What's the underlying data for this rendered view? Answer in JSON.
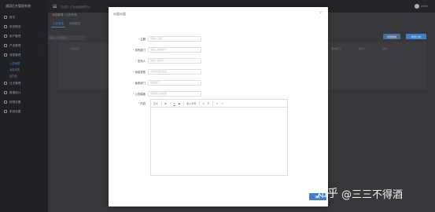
{
  "app": {
    "title": "通用后台管理系统",
    "notice": "欢迎您 · 平台运营管理中心",
    "user": "admin"
  },
  "sidebar": {
    "items": [
      {
        "label": "首页",
        "icon": "home-icon"
      },
      {
        "label": "系统概览",
        "icon": "dashboard-icon"
      },
      {
        "label": "用户管理",
        "icon": "user-icon",
        "arrow": "⌄"
      },
      {
        "label": "产品管理",
        "icon": "box-icon",
        "arrow": "⌄"
      },
      {
        "label": "消息管理",
        "icon": "message-icon",
        "arrow": "⌃"
      }
    ],
    "subitems": [
      {
        "label": "公告管理",
        "active": true
      },
      {
        "label": "消息列表",
        "active": false
      },
      {
        "label": "站内信",
        "active": false
      }
    ],
    "items2": [
      {
        "label": "日志管理",
        "icon": "log-icon"
      },
      {
        "label": "数据统计",
        "icon": "chart-icon"
      },
      {
        "label": "权限设置",
        "icon": "lock-icon"
      },
      {
        "label": "系统设置",
        "icon": "gear-icon"
      }
    ]
  },
  "background": {
    "breadcrumb": "消息管理 / 公告列表",
    "tabs": [
      "公告管理",
      "消息推送"
    ],
    "search_placeholder": "请输入公告标题",
    "buttons": [
      "批量删除",
      "新增公告"
    ],
    "columns": [
      "公告名称",
      "发布部门",
      "发布人",
      "操作"
    ]
  },
  "modal": {
    "title": "公告公告",
    "fields": [
      {
        "label": "主题",
        "required": true,
        "placeholder": "请输入主题",
        "select": false
      },
      {
        "label": "发布部门",
        "required": true,
        "placeholder": "请输入发布部门",
        "select": true
      },
      {
        "label": "发布人",
        "required": true,
        "placeholder": "请输入发布人",
        "select": false
      },
      {
        "label": "消息类型",
        "required": true,
        "placeholder": "请选择消息类型",
        "select": true
      },
      {
        "label": "接收部门",
        "required": true,
        "placeholder": "接收部门",
        "select": true
      },
      {
        "label": "公告模板",
        "required": true,
        "placeholder": "请选择公告模板",
        "select": true
      }
    ],
    "content_label": "内容",
    "toolbar": {
      "paragraph": "正文",
      "bold": "B",
      "italic": "I",
      "underline": "U",
      "strike": "S",
      "fontsize": "默认字号",
      "align": "≡",
      "list": "☰",
      "undo": "↶",
      "redo": "↷"
    },
    "ok_label": "确定"
  },
  "watermark": {
    "brand": "知乎",
    "handle": "@三三不得酒"
  },
  "colors": {
    "accent": "#3e7fcf",
    "required": "#e5484d",
    "sidebar_bg": "#1f2124"
  }
}
